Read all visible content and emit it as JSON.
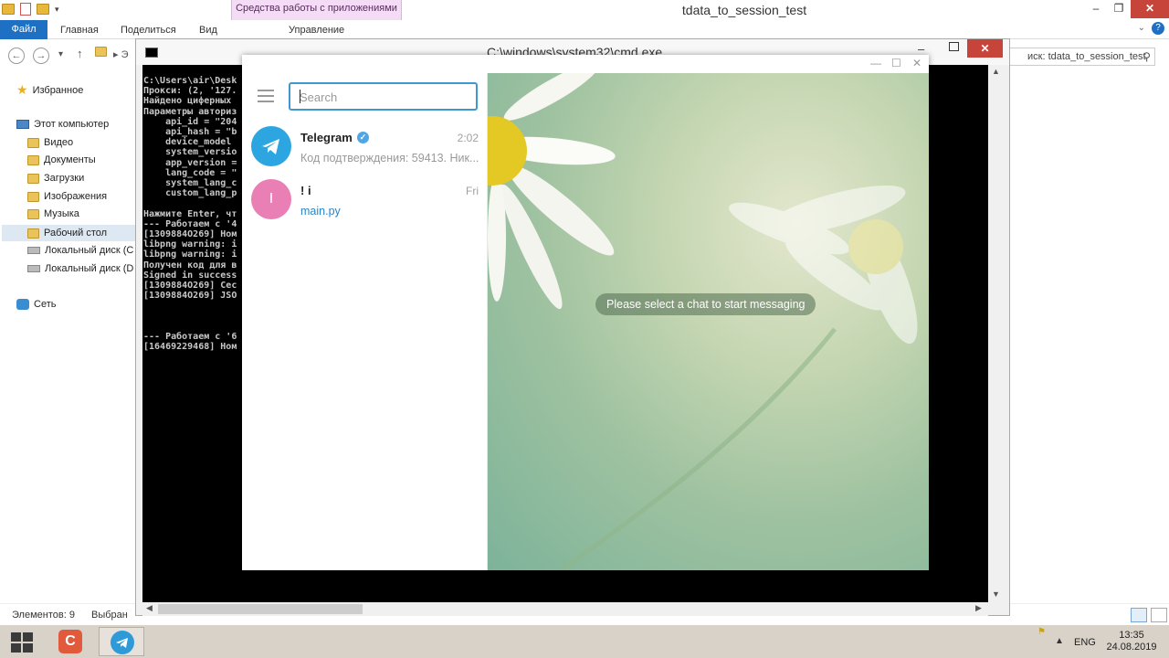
{
  "explorer": {
    "title": "tdata_to_session_test",
    "tools_tab": "Средства работы с приложениями",
    "ribbon": {
      "file": "Файл",
      "tabs": [
        "Главная",
        "Поделиться",
        "Вид"
      ],
      "manage": "Управление"
    },
    "address_partial": "Э",
    "search_text": "иск: tdata_to_session_test",
    "nav": {
      "favorites": "Избранное",
      "computer": "Этот компьютер",
      "video": "Видео",
      "documents": "Документы",
      "downloads": "Загрузки",
      "images": "Изображения",
      "music": "Музыка",
      "desktop": "Рабочий стол",
      "disk_c": "Локальный диск (С",
      "disk_d": "Локальный диск (D",
      "network": "Сеть"
    },
    "status": {
      "items": "Элементов: 9",
      "selected": "Выбран"
    }
  },
  "cmd": {
    "title": "C:\\windows\\system32\\cmd.exe",
    "lines": [
      "C:\\Users\\air\\Desk",
      "Прокси: (2, '127.",
      "Найдено циферных",
      "Параметры авториз",
      "    api_id = \"204",
      "    api_hash = \"b",
      "    device_model",
      "    system_versio",
      "    app_version =",
      "    lang_code = \"",
      "    system_lang_c",
      "    custom_lang_p",
      "",
      "Нажмите Enter, чт",
      "--- Работаем с '4",
      "[1309884O269] Ном",
      "libpng warning: i",
      "libpng warning: i",
      "Получен код для в",
      "Signed in success",
      "[1309884O269] Сес",
      "[1309884O269] JSO",
      "",
      "",
      "",
      "--- Работаем с '6",
      "[16469229468] Ном"
    ]
  },
  "telegram": {
    "search_placeholder": "Search",
    "chats": [
      {
        "name": "Telegram",
        "time": "2:02",
        "preview": "Код подтверждения: 59413. Ник...",
        "avatar_color": "#2ca5e0",
        "avatar_letter": ""
      },
      {
        "name": "! i",
        "time": "Fri",
        "preview": "main.py",
        "avatar_color": "#e97fb5",
        "avatar_letter": "I"
      }
    ],
    "empty_message": "Please select a chat to start messaging"
  },
  "taskbar": {
    "lang": "ENG",
    "time": "13:35",
    "date": "24.08.2019"
  },
  "colors": {
    "accent": "#3f96d0",
    "file_tab": "#1e70c4",
    "close": "#c7443a"
  }
}
